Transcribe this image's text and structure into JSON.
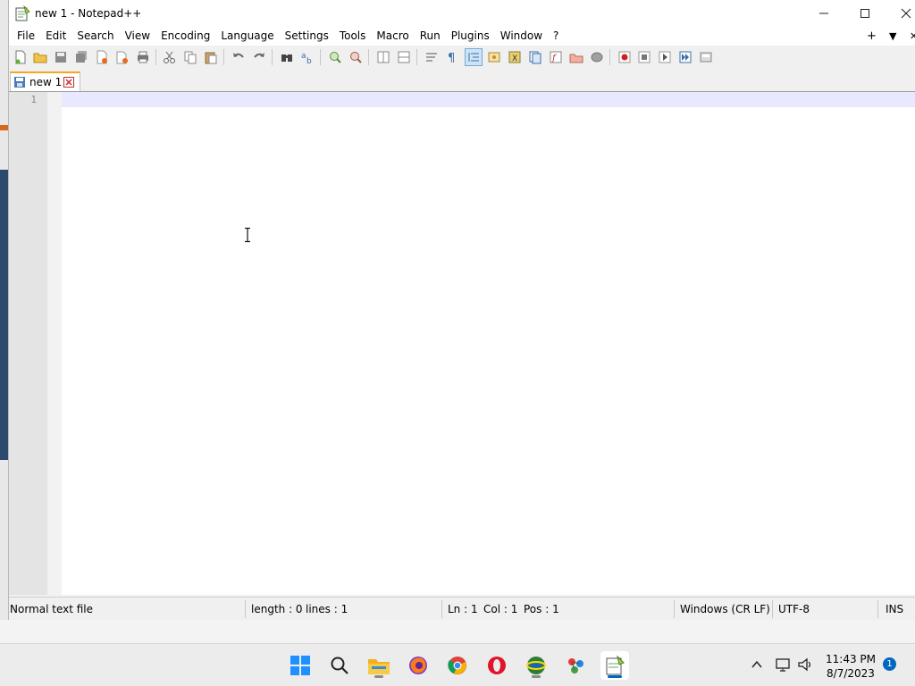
{
  "window": {
    "title": "new 1 - Notepad++"
  },
  "menu": {
    "items": [
      "File",
      "Edit",
      "Search",
      "View",
      "Encoding",
      "Language",
      "Settings",
      "Tools",
      "Macro",
      "Run",
      "Plugins",
      "Window",
      "?"
    ],
    "right": {
      "plus": "+",
      "arrow": "▼",
      "close": "✕"
    }
  },
  "tabs": [
    {
      "label": "new 1"
    }
  ],
  "editor": {
    "line_number": "1",
    "content": ""
  },
  "status": {
    "file_type": "Normal text file",
    "length": "length : 0",
    "lines": "lines : 1",
    "ln": "Ln : 1",
    "col": "Col : 1",
    "pos": "Pos : 1",
    "eol": "Windows (CR LF)",
    "encoding": "UTF-8",
    "mode": "INS"
  },
  "taskbar": {
    "time": "11:43 PM",
    "date": "8/7/2023",
    "notifications": "1"
  },
  "colors": {
    "accent": "#0067c0",
    "tab_highlight": "#f5a623",
    "caret_line": "#e8e8ff"
  }
}
